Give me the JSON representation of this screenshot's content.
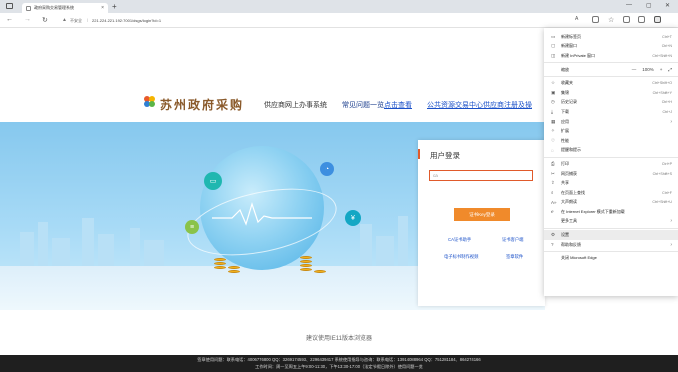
{
  "browser": {
    "tab_title": "政府采购交易管理系统",
    "url_security": "不安全",
    "url": "221.224.221.192:7001/dsgs/login?id=1"
  },
  "header": {
    "logo_text": "苏州政府采购",
    "system_name": "供应商网上办事系统",
    "faq_prefix": "常见问题一览",
    "faq_link": "点击查看",
    "guide_link": "公共资源交易中心供应商注册及操"
  },
  "login": {
    "title": "用户登录",
    "username_value": "ca",
    "ukey_button": "证书Key登录",
    "links": [
      "CA证书助手",
      "证书客户端",
      "电子标书制作视频",
      "签章软件"
    ]
  },
  "recommend": "建议使用IE11版本浏览器",
  "footer": {
    "line1": "签章使用问题：联系电话：4006776800 QQ：3269174593、2296439417 系统使用指导与咨询：联系电话：13914088964 QQ：751281184、864274166",
    "line2": "工作时间：周一至周五上午9:00-11:30，下午13:30-17:00（法定节假日除外）使用问题一览"
  },
  "menu": {
    "items": [
      {
        "icon": "new-tab-icon",
        "glyph": "▭",
        "label": "新建标签页",
        "shortcut": "Ctrl+T"
      },
      {
        "icon": "new-window-icon",
        "glyph": "▢",
        "label": "新建窗口",
        "shortcut": "Ctrl+N"
      },
      {
        "icon": "inprivate-icon",
        "glyph": "◫",
        "label": "新建 InPrivate 窗口",
        "shortcut": "Ctrl+Shift+N"
      }
    ],
    "zoom_label": "缩放",
    "zoom_minus": "—",
    "zoom_value": "100%",
    "zoom_plus": "+",
    "items2": [
      {
        "icon": "favorites-icon",
        "glyph": "☆",
        "label": "收藏夹",
        "shortcut": "Ctrl+Shift+O"
      },
      {
        "icon": "collections-icon",
        "glyph": "▣",
        "label": "集锦",
        "shortcut": "Ctrl+Shift+Y"
      },
      {
        "icon": "history-icon",
        "glyph": "◷",
        "label": "历史记录",
        "shortcut": "Ctrl+H"
      },
      {
        "icon": "downloads-icon",
        "glyph": "⤓",
        "label": "下载",
        "shortcut": "Ctrl+J"
      },
      {
        "icon": "apps-icon",
        "glyph": "▦",
        "label": "应用",
        "arrow": "›"
      },
      {
        "icon": "extensions-icon",
        "glyph": "✧",
        "label": "扩展"
      },
      {
        "icon": "performance-icon",
        "glyph": "♡",
        "label": "性能"
      },
      {
        "icon": "alerts-icon",
        "glyph": "◌",
        "label": "提醒和提示"
      }
    ],
    "items3": [
      {
        "icon": "print-icon",
        "glyph": "⎙",
        "label": "打印",
        "shortcut": "Ctrl+P"
      },
      {
        "icon": "web-capture-icon",
        "glyph": "✂",
        "label": "网页捕获",
        "shortcut": "Ctrl+Shift+S"
      },
      {
        "icon": "share-icon",
        "glyph": "⇪",
        "label": "共享"
      },
      {
        "icon": "find-icon",
        "glyph": "⌕",
        "label": "在页面上查找",
        "shortcut": "Ctrl+F"
      },
      {
        "icon": "read-aloud-icon",
        "glyph": "A»",
        "label": "大声朗读",
        "shortcut": "Ctrl+Shift+U"
      },
      {
        "icon": "ie-mode-icon",
        "glyph": "ℯ",
        "label": "在 Internet Explorer 模式下重新加载"
      },
      {
        "icon": "more-tools-icon",
        "glyph": "",
        "label": "更多工具",
        "arrow": "›"
      }
    ],
    "items4": [
      {
        "icon": "settings-icon",
        "glyph": "⚙",
        "label": "设置"
      },
      {
        "icon": "help-icon",
        "glyph": "?",
        "label": "帮助和反馈",
        "arrow": "›"
      }
    ],
    "close_label": "关闭 Microsoft Edge"
  }
}
